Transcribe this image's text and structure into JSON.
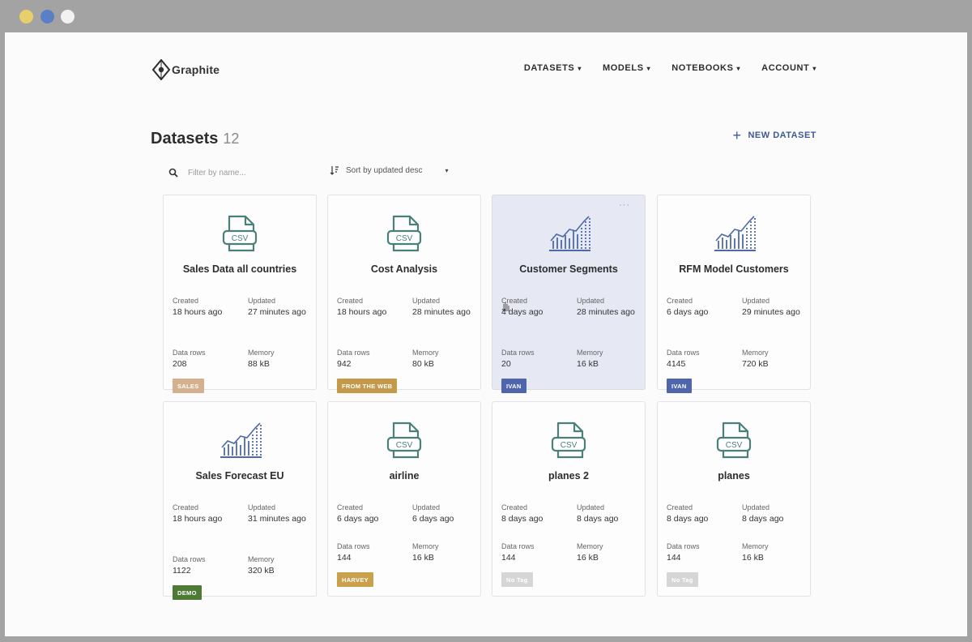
{
  "window_controls": [
    "close",
    "minimize",
    "maximize"
  ],
  "brand": {
    "name": "Graphite",
    "logo_icon": "diamond-logo-icon"
  },
  "nav": {
    "items": [
      {
        "label": "DATASETS"
      },
      {
        "label": "MODELS"
      },
      {
        "label": "NOTEBOOKS"
      },
      {
        "label": "ACCOUNT"
      }
    ],
    "caret": "▾"
  },
  "page": {
    "title": "Datasets",
    "count": "12"
  },
  "actions": {
    "new_dataset": "NEW DATASET",
    "plus": "+"
  },
  "search": {
    "placeholder": "Filter by name..."
  },
  "sort": {
    "label": "Sort by updated desc",
    "caret": "▾"
  },
  "labels": {
    "created": "Created",
    "updated": "Updated",
    "data_rows": "Data rows",
    "memory": "Memory"
  },
  "colors": {
    "accent": "#3e5a93",
    "icon_csv": "#4a7f7a",
    "icon_chart": "#4f69a8",
    "tag_sales": "#d4b08f",
    "tag_web": "#c49a4a",
    "tag_ivan": "#4f66ad",
    "tag_demo": "#4f7a35",
    "tag_harvey": "#c9a04c",
    "tag_none": "#d6d6d6"
  },
  "datasets": [
    {
      "title": "Sales Data all countries",
      "icon": "csv-file-icon",
      "created": "18 hours ago",
      "updated": "27 minutes ago",
      "rows": "208",
      "memory": "88 kB",
      "tag": "SALES",
      "tag_color": "#d4b08f"
    },
    {
      "title": "Cost Analysis",
      "icon": "csv-file-icon",
      "created": "18 hours ago",
      "updated": "28 minutes ago",
      "rows": "942",
      "memory": "80 kB",
      "tag": "FROM THE WEB",
      "tag_color": "#c49a4a"
    },
    {
      "title": "Customer Segments",
      "icon": "bar-chart-icon",
      "created": "4 days ago",
      "updated": "28 minutes ago",
      "rows": "20",
      "memory": "16 kB",
      "tag": "IVAN",
      "tag_color": "#4f66ad",
      "highlighted": true,
      "more": "···"
    },
    {
      "title": "RFM Model Customers",
      "icon": "bar-chart-icon",
      "created": "6 days ago",
      "updated": "29 minutes ago",
      "rows": "4145",
      "memory": "720 kB",
      "tag": "IVAN",
      "tag_color": "#4f66ad"
    },
    {
      "title": "Sales Forecast EU",
      "icon": "bar-chart-icon",
      "created": "18 hours ago",
      "updated": "31 minutes ago",
      "rows": "1122",
      "memory": "320 kB",
      "tag": "DEMO",
      "tag_color": "#4f7a35"
    },
    {
      "title": "airline",
      "icon": "csv-file-icon",
      "created": "6 days ago",
      "updated": "6 days ago",
      "rows": "144",
      "memory": "16 kB",
      "tag": "HARVEY",
      "tag_color": "#c9a04c"
    },
    {
      "title": "planes 2",
      "icon": "csv-file-icon",
      "created": "8 days ago",
      "updated": "8 days ago",
      "rows": "144",
      "memory": "16 kB",
      "tag": "No Tag",
      "tag_color": "#d6d6d6"
    },
    {
      "title": "planes",
      "icon": "csv-file-icon",
      "created": "8 days ago",
      "updated": "8 days ago",
      "rows": "144",
      "memory": "16 kB",
      "tag": "No Tag",
      "tag_color": "#d6d6d6"
    }
  ]
}
